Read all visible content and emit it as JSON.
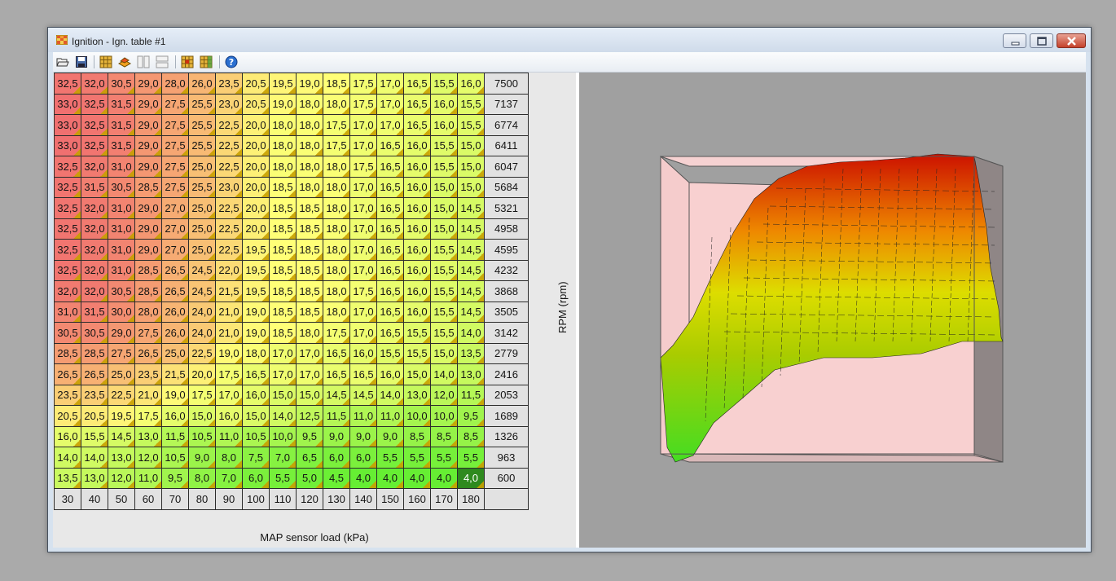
{
  "window": {
    "title": "Ignition - Ign. table #1"
  },
  "toolbar": {
    "buttons": [
      {
        "name": "open-icon"
      },
      {
        "name": "save-icon"
      },
      {
        "name": "grid-view-icon"
      },
      {
        "name": "3d-view-icon"
      },
      {
        "name": "split-vertical-icon"
      },
      {
        "name": "split-horizontal-icon"
      },
      {
        "name": "interpolate-icon"
      },
      {
        "name": "fill-table-icon"
      },
      {
        "name": "help-icon"
      }
    ]
  },
  "table": {
    "rpm_axis_label": "RPM (rpm)",
    "map_axis_label": "MAP sensor load (kPa)",
    "rpm": [
      "7500",
      "7137",
      "6774",
      "6411",
      "6047",
      "5684",
      "5321",
      "4958",
      "4595",
      "4232",
      "3868",
      "3505",
      "3142",
      "2779",
      "2416",
      "2053",
      "1689",
      "1326",
      "963",
      "600"
    ],
    "map": [
      "30",
      "40",
      "50",
      "60",
      "70",
      "80",
      "90",
      "100",
      "110",
      "120",
      "130",
      "140",
      "150",
      "160",
      "170",
      "180"
    ],
    "rows": [
      [
        "32,5",
        "32,0",
        "30,5",
        "29,0",
        "28,0",
        "26,0",
        "23,5",
        "20,5",
        "19,5",
        "19,0",
        "18,5",
        "17,5",
        "17,0",
        "16,5",
        "15,5",
        "16,0"
      ],
      [
        "33,0",
        "32,5",
        "31,5",
        "29,0",
        "27,5",
        "25,5",
        "23,0",
        "20,5",
        "19,0",
        "18,0",
        "18,0",
        "17,5",
        "17,0",
        "16,5",
        "16,0",
        "15,5"
      ],
      [
        "33,0",
        "32,5",
        "31,5",
        "29,0",
        "27,5",
        "25,5",
        "22,5",
        "20,0",
        "18,0",
        "18,0",
        "17,5",
        "17,0",
        "17,0",
        "16,5",
        "16,0",
        "15,5"
      ],
      [
        "33,0",
        "32,5",
        "31,5",
        "29,0",
        "27,5",
        "25,5",
        "22,5",
        "20,0",
        "18,0",
        "18,0",
        "17,5",
        "17,0",
        "16,5",
        "16,0",
        "15,5",
        "15,0"
      ],
      [
        "32,5",
        "32,0",
        "31,0",
        "29,0",
        "27,5",
        "25,0",
        "22,5",
        "20,0",
        "18,0",
        "18,0",
        "18,0",
        "17,5",
        "16,5",
        "16,0",
        "15,5",
        "15,0"
      ],
      [
        "32,5",
        "31,5",
        "30,5",
        "28,5",
        "27,5",
        "25,5",
        "23,0",
        "20,0",
        "18,5",
        "18,0",
        "18,0",
        "17,0",
        "16,5",
        "16,0",
        "15,0",
        "15,0"
      ],
      [
        "32,5",
        "32,0",
        "31,0",
        "29,0",
        "27,0",
        "25,0",
        "22,5",
        "20,0",
        "18,5",
        "18,5",
        "18,0",
        "17,0",
        "16,5",
        "16,0",
        "15,0",
        "14,5"
      ],
      [
        "32,5",
        "32,0",
        "31,0",
        "29,0",
        "27,0",
        "25,0",
        "22,5",
        "20,0",
        "18,5",
        "18,5",
        "18,0",
        "17,0",
        "16,5",
        "16,0",
        "15,0",
        "14,5"
      ],
      [
        "32,5",
        "32,0",
        "31,0",
        "29,0",
        "27,0",
        "25,0",
        "22,5",
        "19,5",
        "18,5",
        "18,5",
        "18,0",
        "17,0",
        "16,5",
        "16,0",
        "15,5",
        "14,5"
      ],
      [
        "32,5",
        "32,0",
        "31,0",
        "28,5",
        "26,5",
        "24,5",
        "22,0",
        "19,5",
        "18,5",
        "18,5",
        "18,0",
        "17,0",
        "16,5",
        "16,0",
        "15,5",
        "14,5"
      ],
      [
        "32,0",
        "32,0",
        "30,5",
        "28,5",
        "26,5",
        "24,5",
        "21,5",
        "19,5",
        "18,5",
        "18,5",
        "18,0",
        "17,5",
        "16,5",
        "16,0",
        "15,5",
        "14,5"
      ],
      [
        "31,0",
        "31,5",
        "30,0",
        "28,0",
        "26,0",
        "24,0",
        "21,0",
        "19,0",
        "18,5",
        "18,5",
        "18,0",
        "17,0",
        "16,5",
        "16,0",
        "15,5",
        "14,5"
      ],
      [
        "30,5",
        "30,5",
        "29,0",
        "27,5",
        "26,0",
        "24,0",
        "21,0",
        "19,0",
        "18,5",
        "18,0",
        "17,5",
        "17,0",
        "16,5",
        "15,5",
        "15,5",
        "14,0"
      ],
      [
        "28,5",
        "28,5",
        "27,5",
        "26,5",
        "25,0",
        "22,5",
        "19,0",
        "18,0",
        "17,0",
        "17,0",
        "16,5",
        "16,0",
        "15,5",
        "15,5",
        "15,0",
        "13,5"
      ],
      [
        "26,5",
        "26,5",
        "25,0",
        "23,5",
        "21,5",
        "20,0",
        "17,5",
        "16,5",
        "17,0",
        "17,0",
        "16,5",
        "16,5",
        "16,0",
        "15,0",
        "14,0",
        "13,0"
      ],
      [
        "23,5",
        "23,5",
        "22,5",
        "21,0",
        "19,0",
        "17,5",
        "17,0",
        "16,0",
        "15,0",
        "15,0",
        "14,5",
        "14,5",
        "14,0",
        "13,0",
        "12,0",
        "11,5"
      ],
      [
        "20,5",
        "20,5",
        "19,5",
        "17,5",
        "16,0",
        "15,0",
        "16,0",
        "15,0",
        "14,0",
        "12,5",
        "11,5",
        "11,0",
        "11,0",
        "10,0",
        "10,0",
        "9,5"
      ],
      [
        "16,0",
        "15,5",
        "14,5",
        "13,0",
        "11,5",
        "10,5",
        "11,0",
        "10,5",
        "10,0",
        "9,5",
        "9,0",
        "9,0",
        "9,0",
        "8,5",
        "8,5",
        "8,5"
      ],
      [
        "14,0",
        "14,0",
        "13,0",
        "12,0",
        "10,5",
        "9,0",
        "8,0",
        "7,5",
        "7,0",
        "6,5",
        "6,0",
        "6,0",
        "5,5",
        "5,5",
        "5,5",
        "5,5"
      ],
      [
        "13,5",
        "13,0",
        "12,0",
        "11,0",
        "9,5",
        "8,0",
        "7,0",
        "6,0",
        "5,5",
        "5,0",
        "4,5",
        "4,0",
        "4,0",
        "4,0",
        "4,0",
        "4,0"
      ]
    ],
    "selected_cell": {
      "row": 19,
      "col": 15
    },
    "colors": {
      "low": "#66ee33",
      "mid": "#ffff77",
      "high": "#f07070",
      "selected": "#2f8a1e"
    }
  },
  "graph": {
    "background": "#a0a0a0",
    "box_face": "#f8d0d0",
    "surface_low": "#55ee22",
    "surface_high": "#dd1100"
  }
}
